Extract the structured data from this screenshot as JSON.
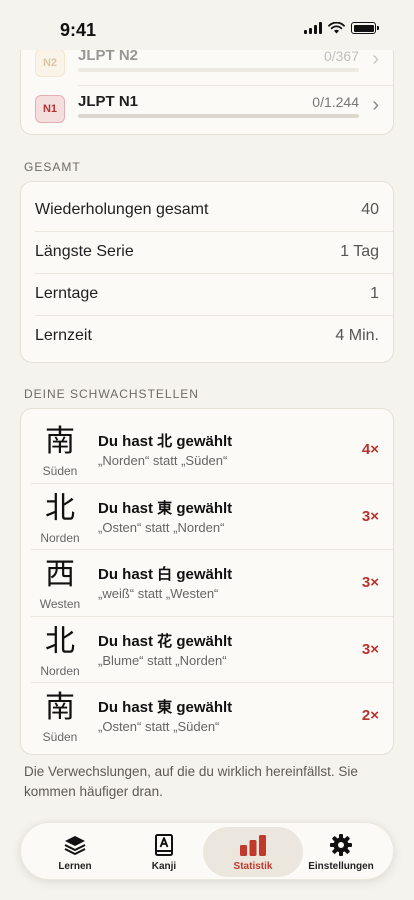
{
  "status": {
    "time": "9:41"
  },
  "jlpt": [
    {
      "badge": "N2",
      "label": "JLPT N2",
      "count": "0/367",
      "progress": 0
    },
    {
      "badge": "N1",
      "label": "JLPT N1",
      "count": "0/1.244",
      "progress": 0
    }
  ],
  "totals": {
    "section": "GESAMT",
    "rows": [
      {
        "label": "Wiederholungen gesamt",
        "value": "40"
      },
      {
        "label": "Längste Serie",
        "value": "1 Tag"
      },
      {
        "label": "Lerntage",
        "value": "1"
      },
      {
        "label": "Lernzeit",
        "value": "4 Min."
      }
    ]
  },
  "weak": {
    "section": "DEINE SCHWACHSTELLEN",
    "items": [
      {
        "kanji": "南",
        "meaning": "Süden",
        "title": "Du hast 北 gewählt",
        "detail": "„Norden“ statt „Süden“",
        "count": "4×"
      },
      {
        "kanji": "北",
        "meaning": "Norden",
        "title": "Du hast 東 gewählt",
        "detail": "„Osten“ statt „Norden“",
        "count": "3×"
      },
      {
        "kanji": "西",
        "meaning": "Westen",
        "title": "Du hast 白 gewählt",
        "detail": "„weiß“ statt „Westen“",
        "count": "3×"
      },
      {
        "kanji": "北",
        "meaning": "Norden",
        "title": "Du hast 花 gewählt",
        "detail": "„Blume“ statt „Norden“",
        "count": "3×"
      },
      {
        "kanji": "南",
        "meaning": "Süden",
        "title": "Du hast 東 gewählt",
        "detail": "„Osten“ statt „Süden“",
        "count": "2×"
      }
    ],
    "footnote": "Die Verwechslungen, auf die du wirklich hereinfällst. Sie kommen häufiger dran."
  },
  "tabs": [
    {
      "label": "Lernen",
      "icon": "stack-icon"
    },
    {
      "label": "Kanji",
      "icon": "kanji-book-icon"
    },
    {
      "label": "Statistik",
      "icon": "bar-chart-icon",
      "active": true
    },
    {
      "label": "Einstellungen",
      "icon": "gear-icon"
    }
  ],
  "colors": {
    "accent": "#c0392b",
    "background": "#f5f3ee"
  }
}
